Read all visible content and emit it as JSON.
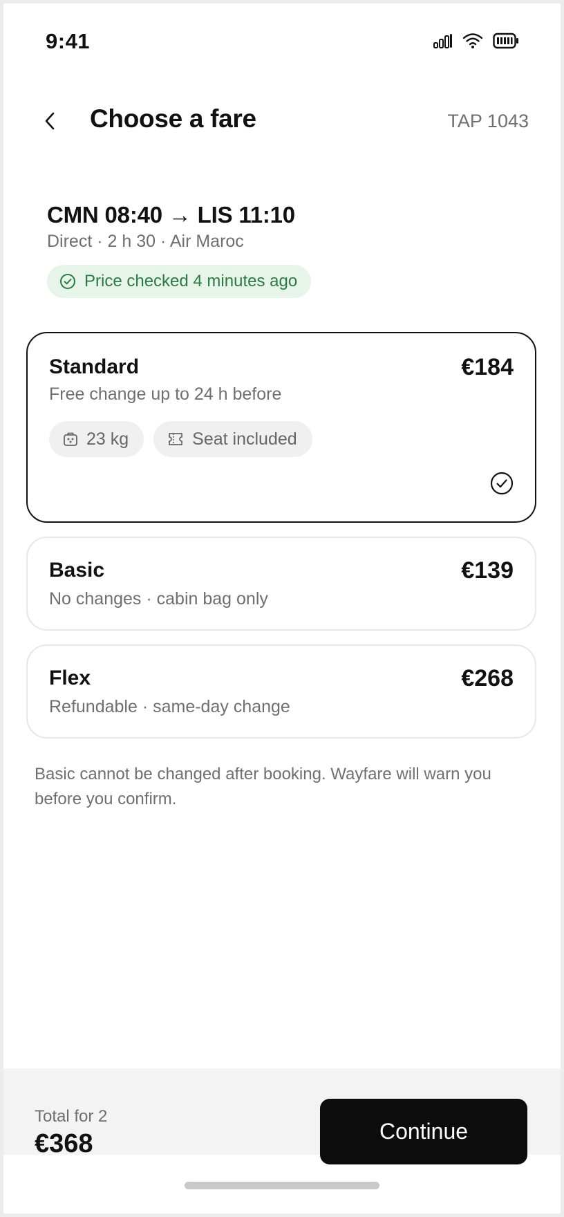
{
  "status_bar": {
    "time": "9:41",
    "icons": [
      "signal-icon",
      "wifi-icon",
      "battery-icon"
    ]
  },
  "header": {
    "title": "Choose a fare",
    "flight_code": "TAP 1043",
    "back_icon": "chevron-left-icon"
  },
  "flight": {
    "route": "CMN 08:40 → LIS 11:10",
    "meta": "Direct · 2 h 30 · Air Maroc",
    "price_check": "Price checked 4 minutes ago"
  },
  "fares": [
    {
      "name": "Standard",
      "price": "€184",
      "description": "Free change up to 24 h before",
      "selected": true,
      "features": [
        {
          "icon": "luggage-icon",
          "label": "23 kg"
        },
        {
          "icon": "seat-icon",
          "label": "Seat included"
        }
      ]
    },
    {
      "name": "Basic",
      "price": "€139",
      "description": "No changes · cabin bag only",
      "selected": false
    },
    {
      "name": "Flex",
      "price": "€268",
      "description": "Refundable · same-day change",
      "selected": false
    }
  ],
  "note": "Basic cannot be changed after booking. Wayfare will warn you before you confirm.",
  "footer": {
    "total_label": "Total for 2",
    "total_value": "€368",
    "continue_label": "Continue"
  },
  "colors": {
    "accent": "#0c0c0c",
    "success_bg": "#e6f4e9",
    "success_text": "#2c7a42",
    "muted_text": "#6f6f6f",
    "card_border": "#e7e7e7"
  }
}
